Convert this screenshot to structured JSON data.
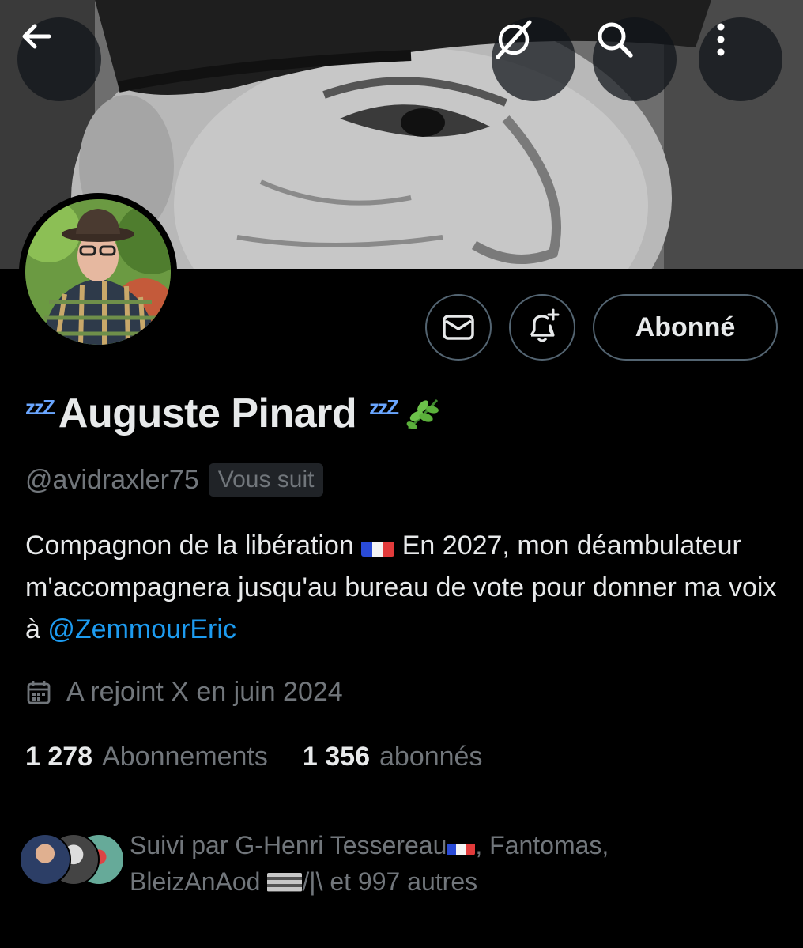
{
  "header": {
    "back_icon": "arrow-left-icon",
    "grok_icon": "grok-icon",
    "search_icon": "search-icon",
    "more_icon": "more-vertical-icon"
  },
  "actions": {
    "message_icon": "envelope-icon",
    "notify_icon": "bell-plus-icon",
    "follow_label": "Abonné"
  },
  "profile": {
    "zzz": "zzZ",
    "display_name": "Auguste Pinard",
    "name_emoji": "🌿",
    "handle": "@avidraxler75",
    "follows_you": "Vous suit",
    "bio_part1": "Compagnon de la libération",
    "bio_part2": "En 2027, mon déambulateur m'accompagnera jusqu'au bureau de vote pour donner ma voix à",
    "bio_mention": "@ZemmourEric",
    "joined": "A rejoint X en juin 2024",
    "calendar_icon": "calendar-icon"
  },
  "stats": {
    "following_count": "1 278",
    "following_label": "Abonnements",
    "followers_count": "1 356",
    "followers_label": "abonnés"
  },
  "followed_by": {
    "prefix": "Suivi par",
    "name1": "G-Henri Tessereau",
    "name2": ", Fantomas,",
    "name3": "BleizAnAod",
    "suffix": "/|\\ et 997 autres"
  },
  "colors": {
    "background": "#000000",
    "text": "#e7e9ea",
    "muted": "#71767b",
    "link": "#1d9bf0",
    "border": "#536471"
  }
}
